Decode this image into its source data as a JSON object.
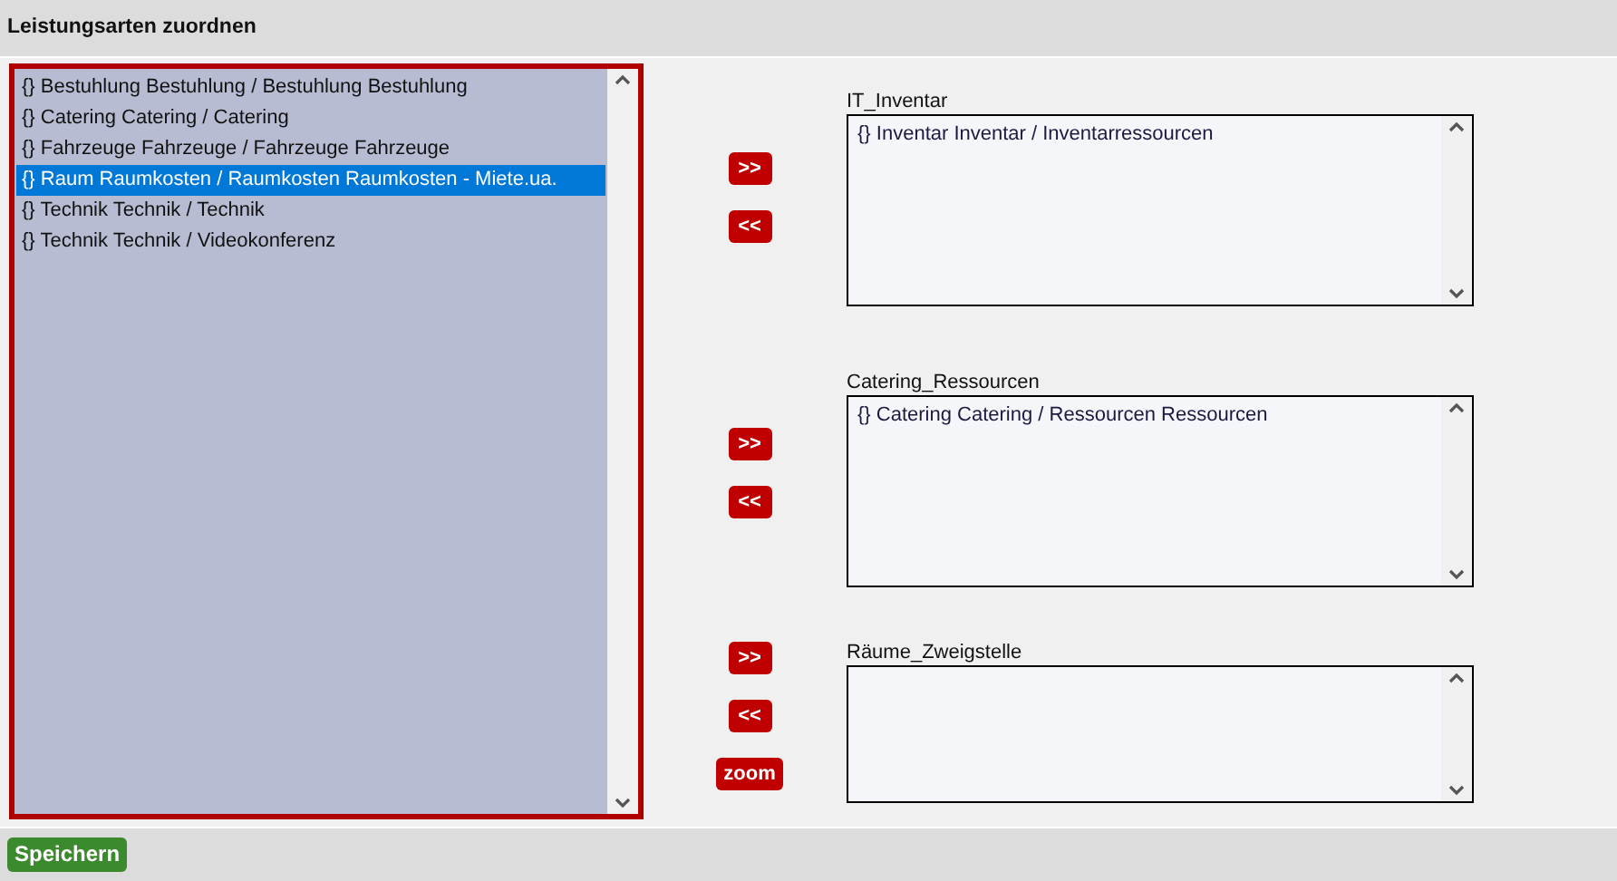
{
  "header": {
    "title": "Leistungsarten zuordnen"
  },
  "source_list": {
    "items": [
      {
        "label": "{} Bestuhlung Bestuhlung / Bestuhlung Bestuhlung",
        "selected": false
      },
      {
        "label": "{} Catering Catering / Catering",
        "selected": false
      },
      {
        "label": "{} Fahrzeuge Fahrzeuge / Fahrzeuge Fahrzeuge",
        "selected": false
      },
      {
        "label": "{} Raum Raumkosten / Raumkosten Raumkosten - Miete.ua.",
        "selected": true
      },
      {
        "label": "{} Technik Technik / Technik",
        "selected": false
      },
      {
        "label": "{} Technik Technik / Videokonferenz",
        "selected": false
      }
    ]
  },
  "targets": [
    {
      "label": "IT_Inventar",
      "buttons": [
        ">>",
        "<<"
      ],
      "items": [
        "{} Inventar Inventar / Inventarressourcen"
      ]
    },
    {
      "label": "Catering_Ressourcen",
      "buttons": [
        ">>",
        "<<"
      ],
      "items": [
        "{} Catering Catering / Ressourcen Ressourcen"
      ]
    },
    {
      "label": "Räume_Zweigstelle",
      "buttons": [
        ">>",
        "<<",
        "zoom"
      ]
    }
  ],
  "footer": {
    "save_button": "Speichern"
  }
}
